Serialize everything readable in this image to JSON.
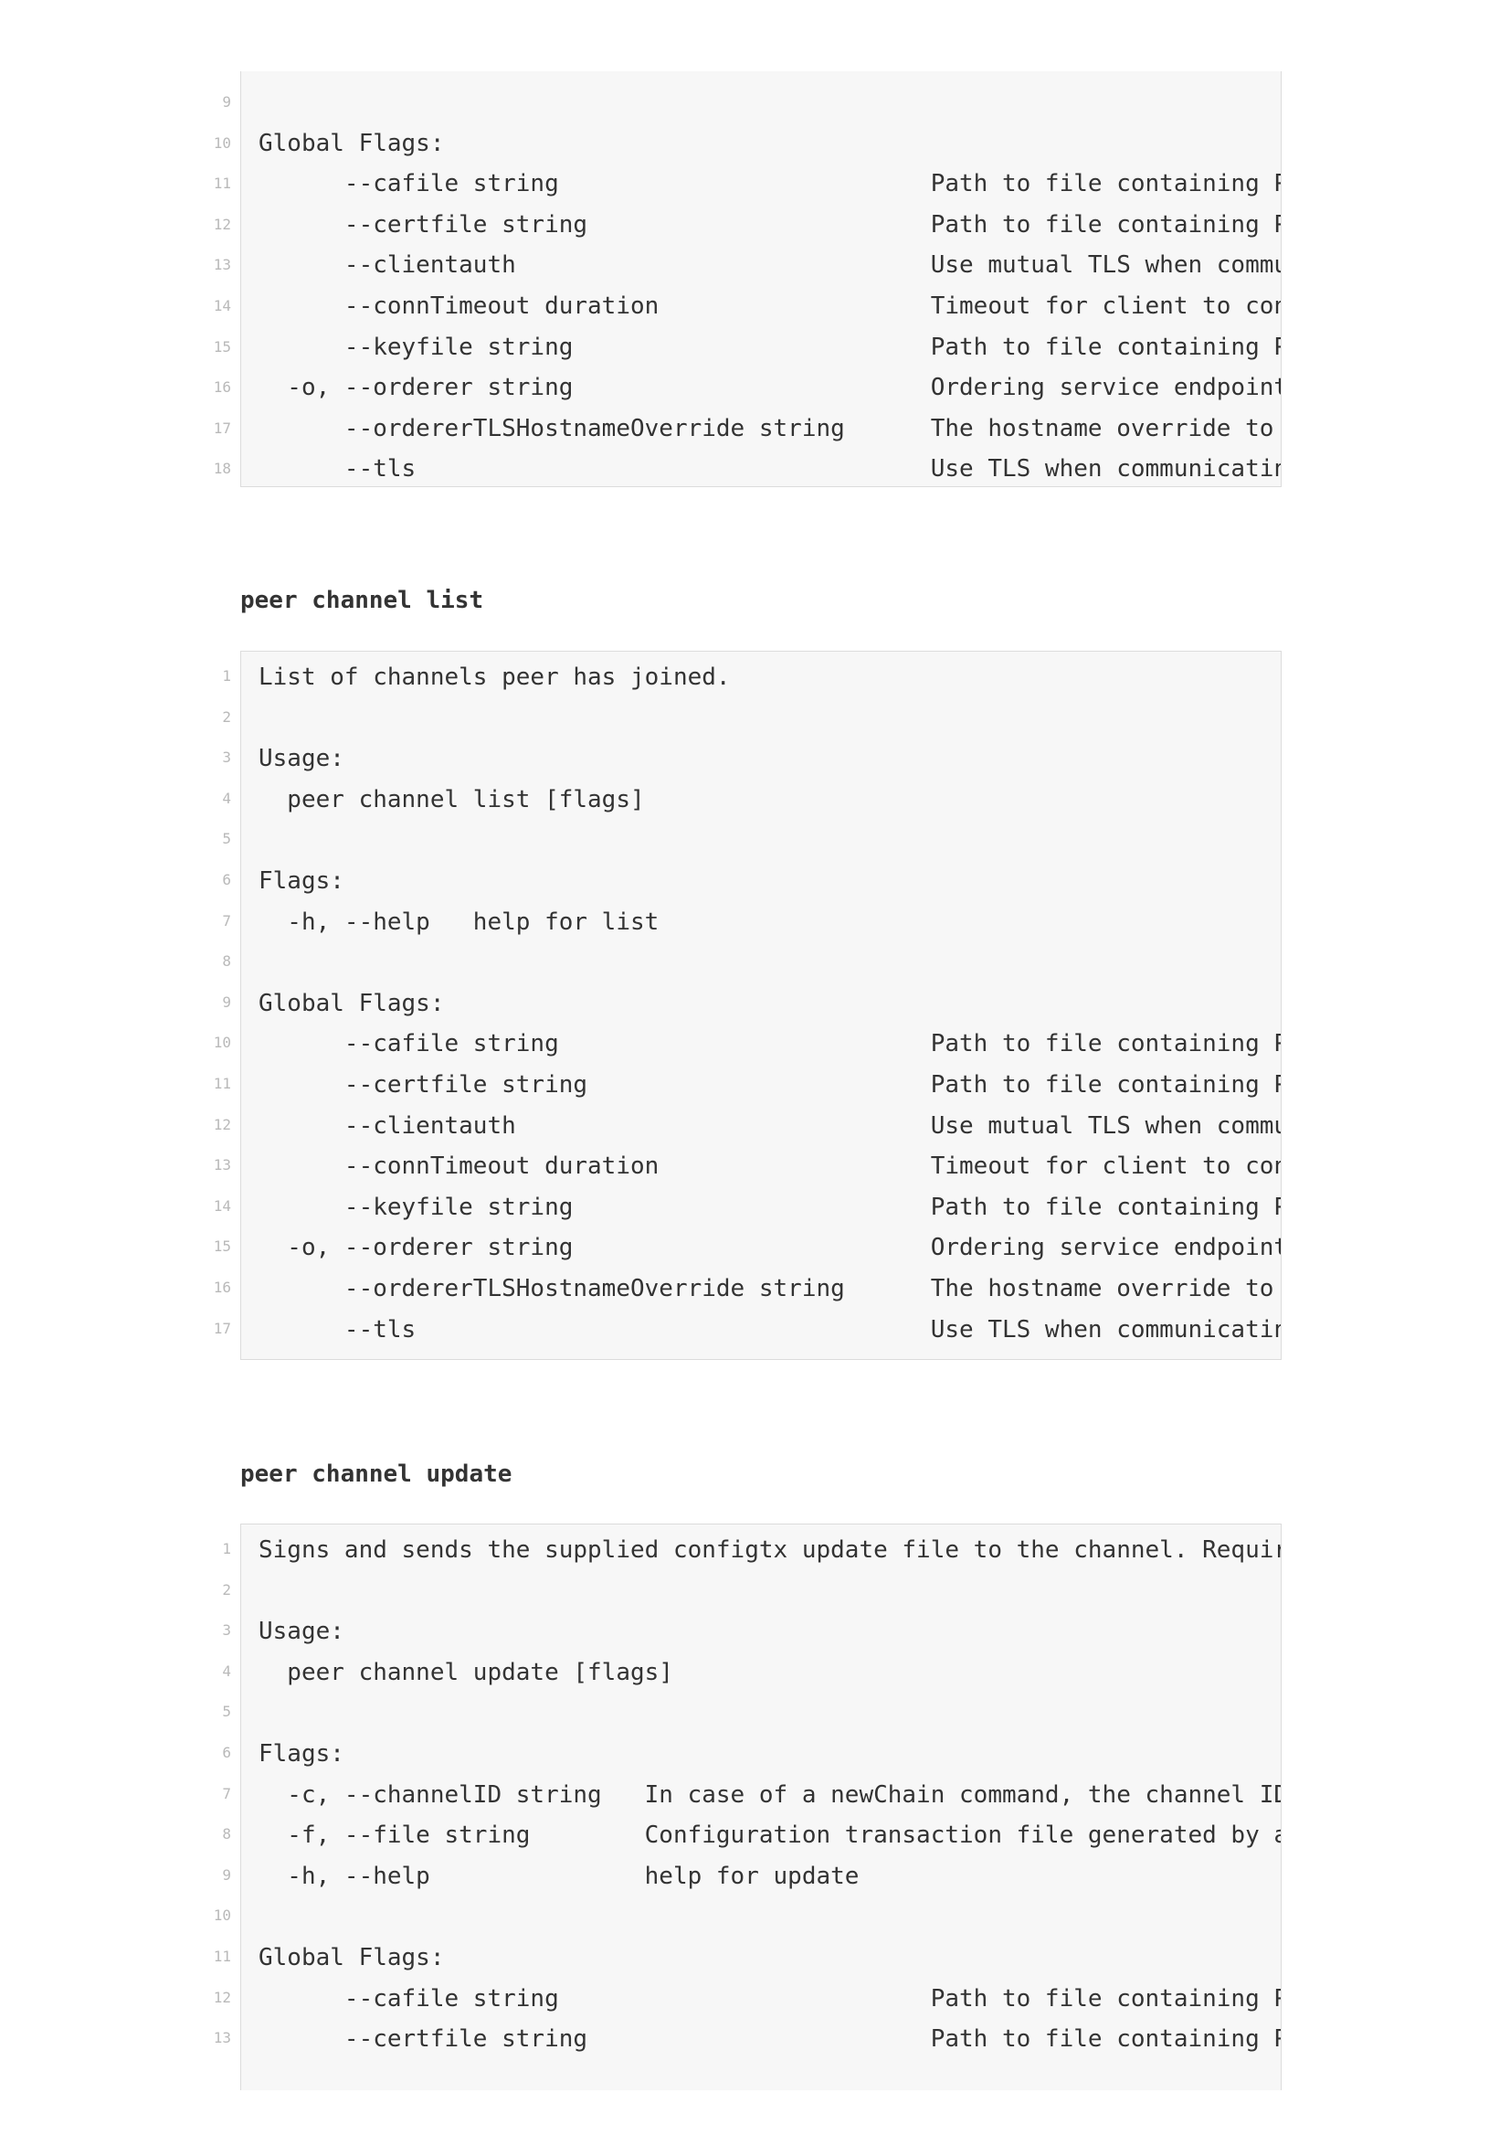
{
  "sections": [
    {
      "heading": "",
      "lines": [
        {
          "n": "9",
          "text": ""
        },
        {
          "n": "10",
          "text": "Global Flags:"
        },
        {
          "n": "11",
          "text": "      --cafile string                          Path to file containing PEM-enco"
        },
        {
          "n": "12",
          "text": "      --certfile string                        Path to file containing PEM-enco"
        },
        {
          "n": "13",
          "text": "      --clientauth                             Use mutual TLS when communicatin"
        },
        {
          "n": "14",
          "text": "      --connTimeout duration                   Timeout for client to connect (d"
        },
        {
          "n": "15",
          "text": "      --keyfile string                         Path to file containing PEM-enco"
        },
        {
          "n": "16",
          "text": "  -o, --orderer string                         Ordering service endpoint"
        },
        {
          "n": "17",
          "text": "      --ordererTLSHostnameOverride string      The hostname override to use whe"
        },
        {
          "n": "18",
          "text": "      --tls                                    Use TLS when communicating with "
        }
      ]
    },
    {
      "heading": "peer channel list",
      "lines": [
        {
          "n": "1",
          "text": "List of channels peer has joined."
        },
        {
          "n": "2",
          "text": ""
        },
        {
          "n": "3",
          "text": "Usage:"
        },
        {
          "n": "4",
          "text": "  peer channel list [flags]"
        },
        {
          "n": "5",
          "text": ""
        },
        {
          "n": "6",
          "text": "Flags:"
        },
        {
          "n": "7",
          "text": "  -h, --help   help for list"
        },
        {
          "n": "8",
          "text": ""
        },
        {
          "n": "9",
          "text": "Global Flags:"
        },
        {
          "n": "10",
          "text": "      --cafile string                          Path to file containing PEM-enco"
        },
        {
          "n": "11",
          "text": "      --certfile string                        Path to file containing PEM-enco"
        },
        {
          "n": "12",
          "text": "      --clientauth                             Use mutual TLS when communicatin"
        },
        {
          "n": "13",
          "text": "      --connTimeout duration                   Timeout for client to connect (d"
        },
        {
          "n": "14",
          "text": "      --keyfile string                         Path to file containing PEM-enco"
        },
        {
          "n": "15",
          "text": "  -o, --orderer string                         Ordering service endpoint"
        },
        {
          "n": "16",
          "text": "      --ordererTLSHostnameOverride string      The hostname override to use whe"
        },
        {
          "n": "17",
          "text": "      --tls                                    Use TLS when communicating with "
        }
      ]
    },
    {
      "heading": "peer channel update",
      "lines": [
        {
          "n": "1",
          "text": "Signs and sends the supplied configtx update file to the channel. Requires '"
        },
        {
          "n": "2",
          "text": ""
        },
        {
          "n": "3",
          "text": "Usage:"
        },
        {
          "n": "4",
          "text": "  peer channel update [flags]"
        },
        {
          "n": "5",
          "text": ""
        },
        {
          "n": "6",
          "text": "Flags:"
        },
        {
          "n": "7",
          "text": "  -c, --channelID string   In case of a newChain command, the channel ID to "
        },
        {
          "n": "8",
          "text": "  -f, --file string        Configuration transaction file generated by a tool"
        },
        {
          "n": "9",
          "text": "  -h, --help               help for update"
        },
        {
          "n": "10",
          "text": ""
        },
        {
          "n": "11",
          "text": "Global Flags:"
        },
        {
          "n": "12",
          "text": "      --cafile string                          Path to file containing PEM-enco"
        },
        {
          "n": "13",
          "text": "      --certfile string                        Path to file containing PEM-enco"
        }
      ]
    }
  ]
}
